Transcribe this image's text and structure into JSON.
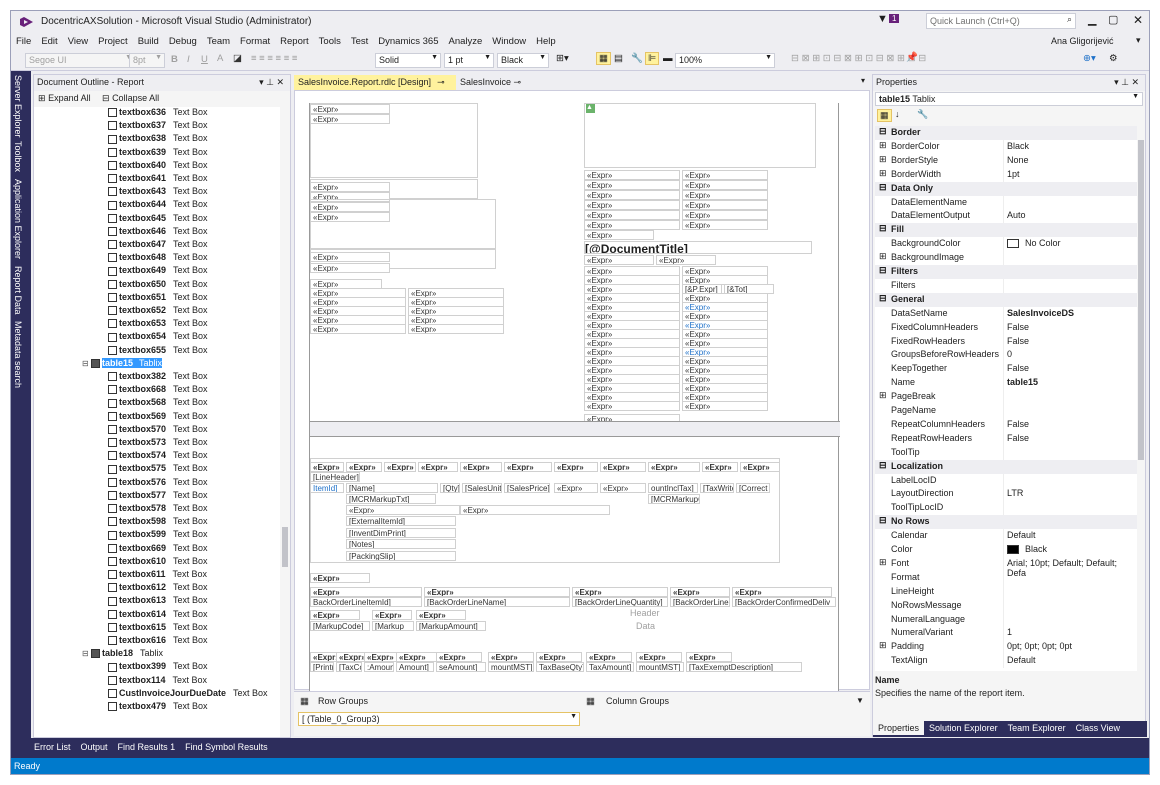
{
  "window": {
    "title": "DocentricAXSolution - Microsoft Visual Studio (Administrator)",
    "quick_launch": "Quick Launch (Ctrl+Q)",
    "notify_count": "1",
    "user": "Ana Gligorijević"
  },
  "menu": [
    "File",
    "Edit",
    "View",
    "Project",
    "Build",
    "Debug",
    "Team",
    "Format",
    "Report",
    "Tools",
    "Test",
    "Dynamics 365",
    "Analyze",
    "Window",
    "Help"
  ],
  "toolbar": {
    "font": "Segoe UI",
    "size": "8pt",
    "border_style": "Solid",
    "border_width": "1 pt",
    "border_color": "Black",
    "zoom": "100%"
  },
  "left_tabs": [
    "Server Explorer",
    "Toolbox",
    "Application Explorer",
    "Report Data",
    "Metadata search"
  ],
  "outline": {
    "title": "Document Outline - Report",
    "expand_all": "Expand All",
    "collapse_all": "Collapse All",
    "items": [
      {
        "name": "textbox636",
        "type": "Text Box"
      },
      {
        "name": "textbox637",
        "type": "Text Box"
      },
      {
        "name": "textbox638",
        "type": "Text Box"
      },
      {
        "name": "textbox639",
        "type": "Text Box"
      },
      {
        "name": "textbox640",
        "type": "Text Box"
      },
      {
        "name": "textbox641",
        "type": "Text Box"
      },
      {
        "name": "textbox643",
        "type": "Text Box"
      },
      {
        "name": "textbox644",
        "type": "Text Box"
      },
      {
        "name": "textbox645",
        "type": "Text Box"
      },
      {
        "name": "textbox646",
        "type": "Text Box"
      },
      {
        "name": "textbox647",
        "type": "Text Box"
      },
      {
        "name": "textbox648",
        "type": "Text Box"
      },
      {
        "name": "textbox649",
        "type": "Text Box"
      },
      {
        "name": "textbox650",
        "type": "Text Box"
      },
      {
        "name": "textbox651",
        "type": "Text Box"
      },
      {
        "name": "textbox652",
        "type": "Text Box"
      },
      {
        "name": "textbox653",
        "type": "Text Box"
      },
      {
        "name": "textbox654",
        "type": "Text Box"
      },
      {
        "name": "textbox655",
        "type": "Text Box"
      }
    ],
    "table15": {
      "name": "table15",
      "type": "Tablix"
    },
    "items2": [
      {
        "name": "textbox382",
        "type": "Text Box"
      },
      {
        "name": "textbox668",
        "type": "Text Box"
      },
      {
        "name": "textbox568",
        "type": "Text Box"
      },
      {
        "name": "textbox569",
        "type": "Text Box"
      },
      {
        "name": "textbox570",
        "type": "Text Box"
      },
      {
        "name": "textbox573",
        "type": "Text Box"
      },
      {
        "name": "textbox574",
        "type": "Text Box"
      },
      {
        "name": "textbox575",
        "type": "Text Box"
      },
      {
        "name": "textbox576",
        "type": "Text Box"
      },
      {
        "name": "textbox577",
        "type": "Text Box"
      },
      {
        "name": "textbox578",
        "type": "Text Box"
      },
      {
        "name": "textbox598",
        "type": "Text Box"
      },
      {
        "name": "textbox599",
        "type": "Text Box"
      },
      {
        "name": "textbox669",
        "type": "Text Box"
      },
      {
        "name": "textbox610",
        "type": "Text Box"
      },
      {
        "name": "textbox611",
        "type": "Text Box"
      },
      {
        "name": "textbox612",
        "type": "Text Box"
      },
      {
        "name": "textbox613",
        "type": "Text Box"
      },
      {
        "name": "textbox614",
        "type": "Text Box"
      },
      {
        "name": "textbox615",
        "type": "Text Box"
      },
      {
        "name": "textbox616",
        "type": "Text Box"
      }
    ],
    "table18": {
      "name": "table18",
      "type": "Tablix"
    },
    "items3": [
      {
        "name": "textbox399",
        "type": "Text Box"
      },
      {
        "name": "textbox114",
        "type": "Text Box"
      },
      {
        "name": "CustInvoiceJourDueDate",
        "type": "Text Box"
      },
      {
        "name": "textbox479",
        "type": "Text Box"
      }
    ]
  },
  "doc_tabs": {
    "active": "SalesInvoice.Report.rdlc [Design]",
    "other": "SalesInvoice"
  },
  "designer": {
    "expr": "«Expr»",
    "doc_title": "[@DocumentTitle]",
    "page_expr": "[&P.Expr]",
    "tot": "[&Tot]",
    "line_header": "[LineHeader]",
    "item_id": "ItemId]",
    "name": "[Name]",
    "qty": "[Qty]",
    "sales_unit": "[SalesUnit",
    "sales_price": "[SalesPrice]",
    "amount_incl_tax": "ountInclTax]",
    "tax_write": "[TaxWrite",
    "correct": "[Correct",
    "mcr_markup_code": "[MCRMarkupC",
    "mcr_markup_txt": "[MCRMarkupTxt]",
    "external_item_id": "[ExternalItemId]",
    "invent_dim_print": "[InventDimPrint]",
    "notes": "[Notes]",
    "packing_slip": "[PackingSlip]",
    "back_line_id": "BackOrderLineItemId]",
    "back_line_name": "[BackOrderLineName]",
    "back_qty": "[BackOrderLineQuantity]",
    "back_line5": "[BackOrderLine5",
    "back_confirmed": "[BackOrderConfirmedDeliv",
    "markup_code": "[MarkupCode]",
    "markup": "[Markup",
    "markup_amount": "[MarkupAmount]",
    "header": "Header",
    "data": "Data",
    "print": "[Print(",
    "tax_co": "[TaxCo",
    "amount": "Amount]",
    "samount": ":Amount]",
    "se_amount": "seAmount]",
    "amount_mst": "mountMST]",
    "tax_base_qty": "TaxBaseQty]",
    "tax_amount": "TaxAmount]",
    "amount_mst2": "mountMST]",
    "tax_exempt": "[TaxExemptDescription]"
  },
  "groups": {
    "row_groups": "Row Groups",
    "column_groups": "Column Groups",
    "row_item": "(Table_0_Group3)"
  },
  "properties": {
    "title": "Properties",
    "object": "table15",
    "object_type": "Tablix",
    "rows": [
      {
        "t": "cat",
        "n": "Border"
      },
      {
        "t": "p",
        "e": "+",
        "n": "BorderColor",
        "v": "Black"
      },
      {
        "t": "p",
        "e": "+",
        "n": "BorderStyle",
        "v": "None"
      },
      {
        "t": "p",
        "e": "+",
        "n": "BorderWidth",
        "v": "1pt"
      },
      {
        "t": "cat",
        "n": "Data Only"
      },
      {
        "t": "p",
        "n": "DataElementName",
        "v": ""
      },
      {
        "t": "p",
        "n": "DataElementOutput",
        "v": "Auto"
      },
      {
        "t": "cat",
        "n": "Fill"
      },
      {
        "t": "p",
        "n": "BackgroundColor",
        "v": "No Color",
        "sw": "#ffffff"
      },
      {
        "t": "p",
        "e": "+",
        "n": "BackgroundImage",
        "v": ""
      },
      {
        "t": "cat",
        "n": "Filters"
      },
      {
        "t": "p",
        "n": "Filters",
        "v": ""
      },
      {
        "t": "cat",
        "n": "General"
      },
      {
        "t": "p",
        "n": "DataSetName",
        "v": "SalesInvoiceDS",
        "bold": true
      },
      {
        "t": "p",
        "n": "FixedColumnHeaders",
        "v": "False"
      },
      {
        "t": "p",
        "n": "FixedRowHeaders",
        "v": "False"
      },
      {
        "t": "p",
        "n": "GroupsBeforeRowHeaders",
        "v": "0"
      },
      {
        "t": "p",
        "n": "KeepTogether",
        "v": "False"
      },
      {
        "t": "p",
        "n": "Name",
        "v": "table15",
        "bold": true
      },
      {
        "t": "p",
        "e": "+",
        "n": "PageBreak",
        "v": ""
      },
      {
        "t": "p",
        "n": "PageName",
        "v": ""
      },
      {
        "t": "p",
        "n": "RepeatColumnHeaders",
        "v": "False"
      },
      {
        "t": "p",
        "n": "RepeatRowHeaders",
        "v": "False"
      },
      {
        "t": "p",
        "n": "ToolTip",
        "v": ""
      },
      {
        "t": "cat",
        "n": "Localization"
      },
      {
        "t": "p",
        "n": "LabelLocID",
        "v": ""
      },
      {
        "t": "p",
        "n": "LayoutDirection",
        "v": "LTR"
      },
      {
        "t": "p",
        "n": "ToolTipLocID",
        "v": ""
      },
      {
        "t": "cat",
        "n": "No Rows"
      },
      {
        "t": "p",
        "n": "Calendar",
        "v": "Default"
      },
      {
        "t": "p",
        "n": "Color",
        "v": "Black",
        "sw": "#000000"
      },
      {
        "t": "p",
        "e": "+",
        "n": "Font",
        "v": "Arial; 10pt; Default; Default; Defa"
      },
      {
        "t": "p",
        "n": "Format",
        "v": ""
      },
      {
        "t": "p",
        "n": "LineHeight",
        "v": ""
      },
      {
        "t": "p",
        "n": "NoRowsMessage",
        "v": ""
      },
      {
        "t": "p",
        "n": "NumeralLanguage",
        "v": ""
      },
      {
        "t": "p",
        "n": "NumeralVariant",
        "v": "1"
      },
      {
        "t": "p",
        "e": "+",
        "n": "Padding",
        "v": "0pt; 0pt; 0pt; 0pt"
      },
      {
        "t": "p",
        "n": "TextAlign",
        "v": "Default"
      }
    ],
    "desc_title": "Name",
    "desc_text": "Specifies the name of the report item.",
    "tabs": [
      "Properties",
      "Solution Explorer",
      "Team Explorer",
      "Class View"
    ]
  },
  "bottom_tabs": [
    "Error List",
    "Output",
    "Find Results 1",
    "Find Symbol Results"
  ],
  "status": "Ready",
  "colors": {
    "accent": "#007acc",
    "tab_active": "#fff29d",
    "strip": "#2d2d5c",
    "select": "#3399ff"
  }
}
